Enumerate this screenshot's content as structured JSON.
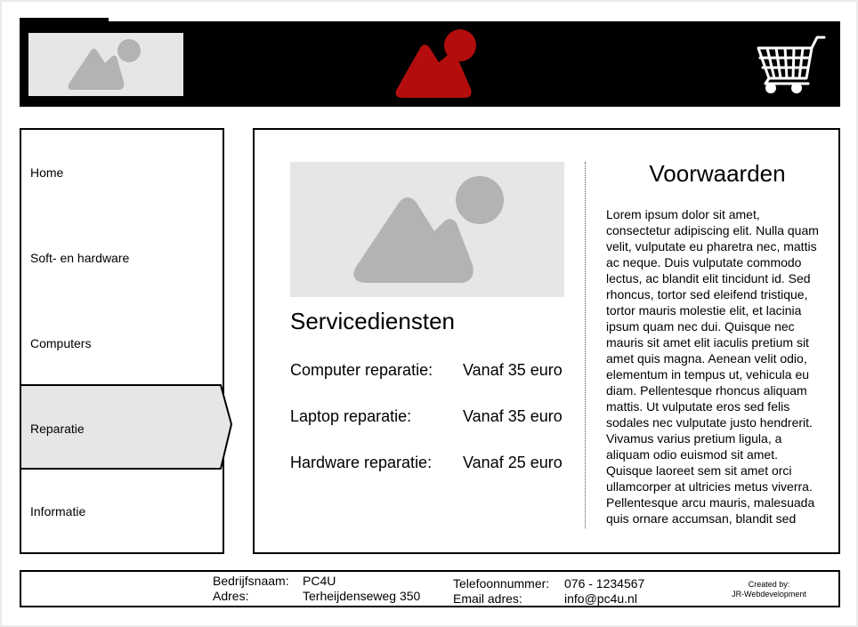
{
  "nav": {
    "items": [
      {
        "label": "Home"
      },
      {
        "label": "Soft- en hardware"
      },
      {
        "label": "Computers"
      },
      {
        "label": "Reparatie"
      },
      {
        "label": "Informatie"
      }
    ],
    "active_index": 3
  },
  "main": {
    "section_title": "Servicediensten",
    "services": [
      {
        "label": "Computer reparatie:",
        "price": "Vanaf 35 euro"
      },
      {
        "label": "Laptop reparatie:",
        "price": "Vanaf 35 euro"
      },
      {
        "label": "Hardware reparatie:",
        "price": "Vanaf 25 euro"
      }
    ],
    "terms_title": "Voorwaarden",
    "terms_body": "Lorem ipsum dolor sit amet, consectetur adipiscing elit. Nulla quam velit, vulputate eu pharetra nec, mattis ac neque. Duis vulputate commodo lectus, ac blandit elit tincidunt id. Sed rhoncus, tortor sed eleifend tristique, tortor mauris molestie elit, et lacinia ipsum quam nec dui. Quisque nec mauris sit amet elit iaculis pretium sit amet quis magna. Aenean velit odio, elementum in tempus ut, vehicula eu diam. Pellentesque rhoncus aliquam mattis. Ut vulputate eros sed felis sodales nec vulputate justo hendrerit. Vivamus varius pretium ligula, a aliquam odio euismod sit amet. Quisque laoreet sem sit amet orci ullamcorper at ultricies metus viverra. Pellentesque arcu mauris, malesuada quis ornare accumsan, blandit sed"
  },
  "footer": {
    "company_label": "Bedrijfsnaam:",
    "company_value": "PC4U",
    "address_label": "Adres:",
    "address_value": "Terheijdenseweg 350",
    "phone_label": "Telefoonnummer:",
    "phone_value": "076 - 1234567",
    "email_label": "Email adres:",
    "email_value": "info@pc4u.nl",
    "credit_line1": "Created by:",
    "credit_line2": "JR-Webdevelopment"
  },
  "icons": {
    "logo_left": "image-placeholder-icon",
    "logo_center": "brand-logo-icon",
    "cart": "shopping-cart-icon",
    "content_image": "image-placeholder-icon"
  },
  "colors": {
    "header_bg": "#000000",
    "brand_red": "#b30d0d",
    "placeholder_bg": "#e6e6e6",
    "placeholder_shape": "#b3b3b3",
    "active_nav_bg": "#e6e6e6"
  }
}
